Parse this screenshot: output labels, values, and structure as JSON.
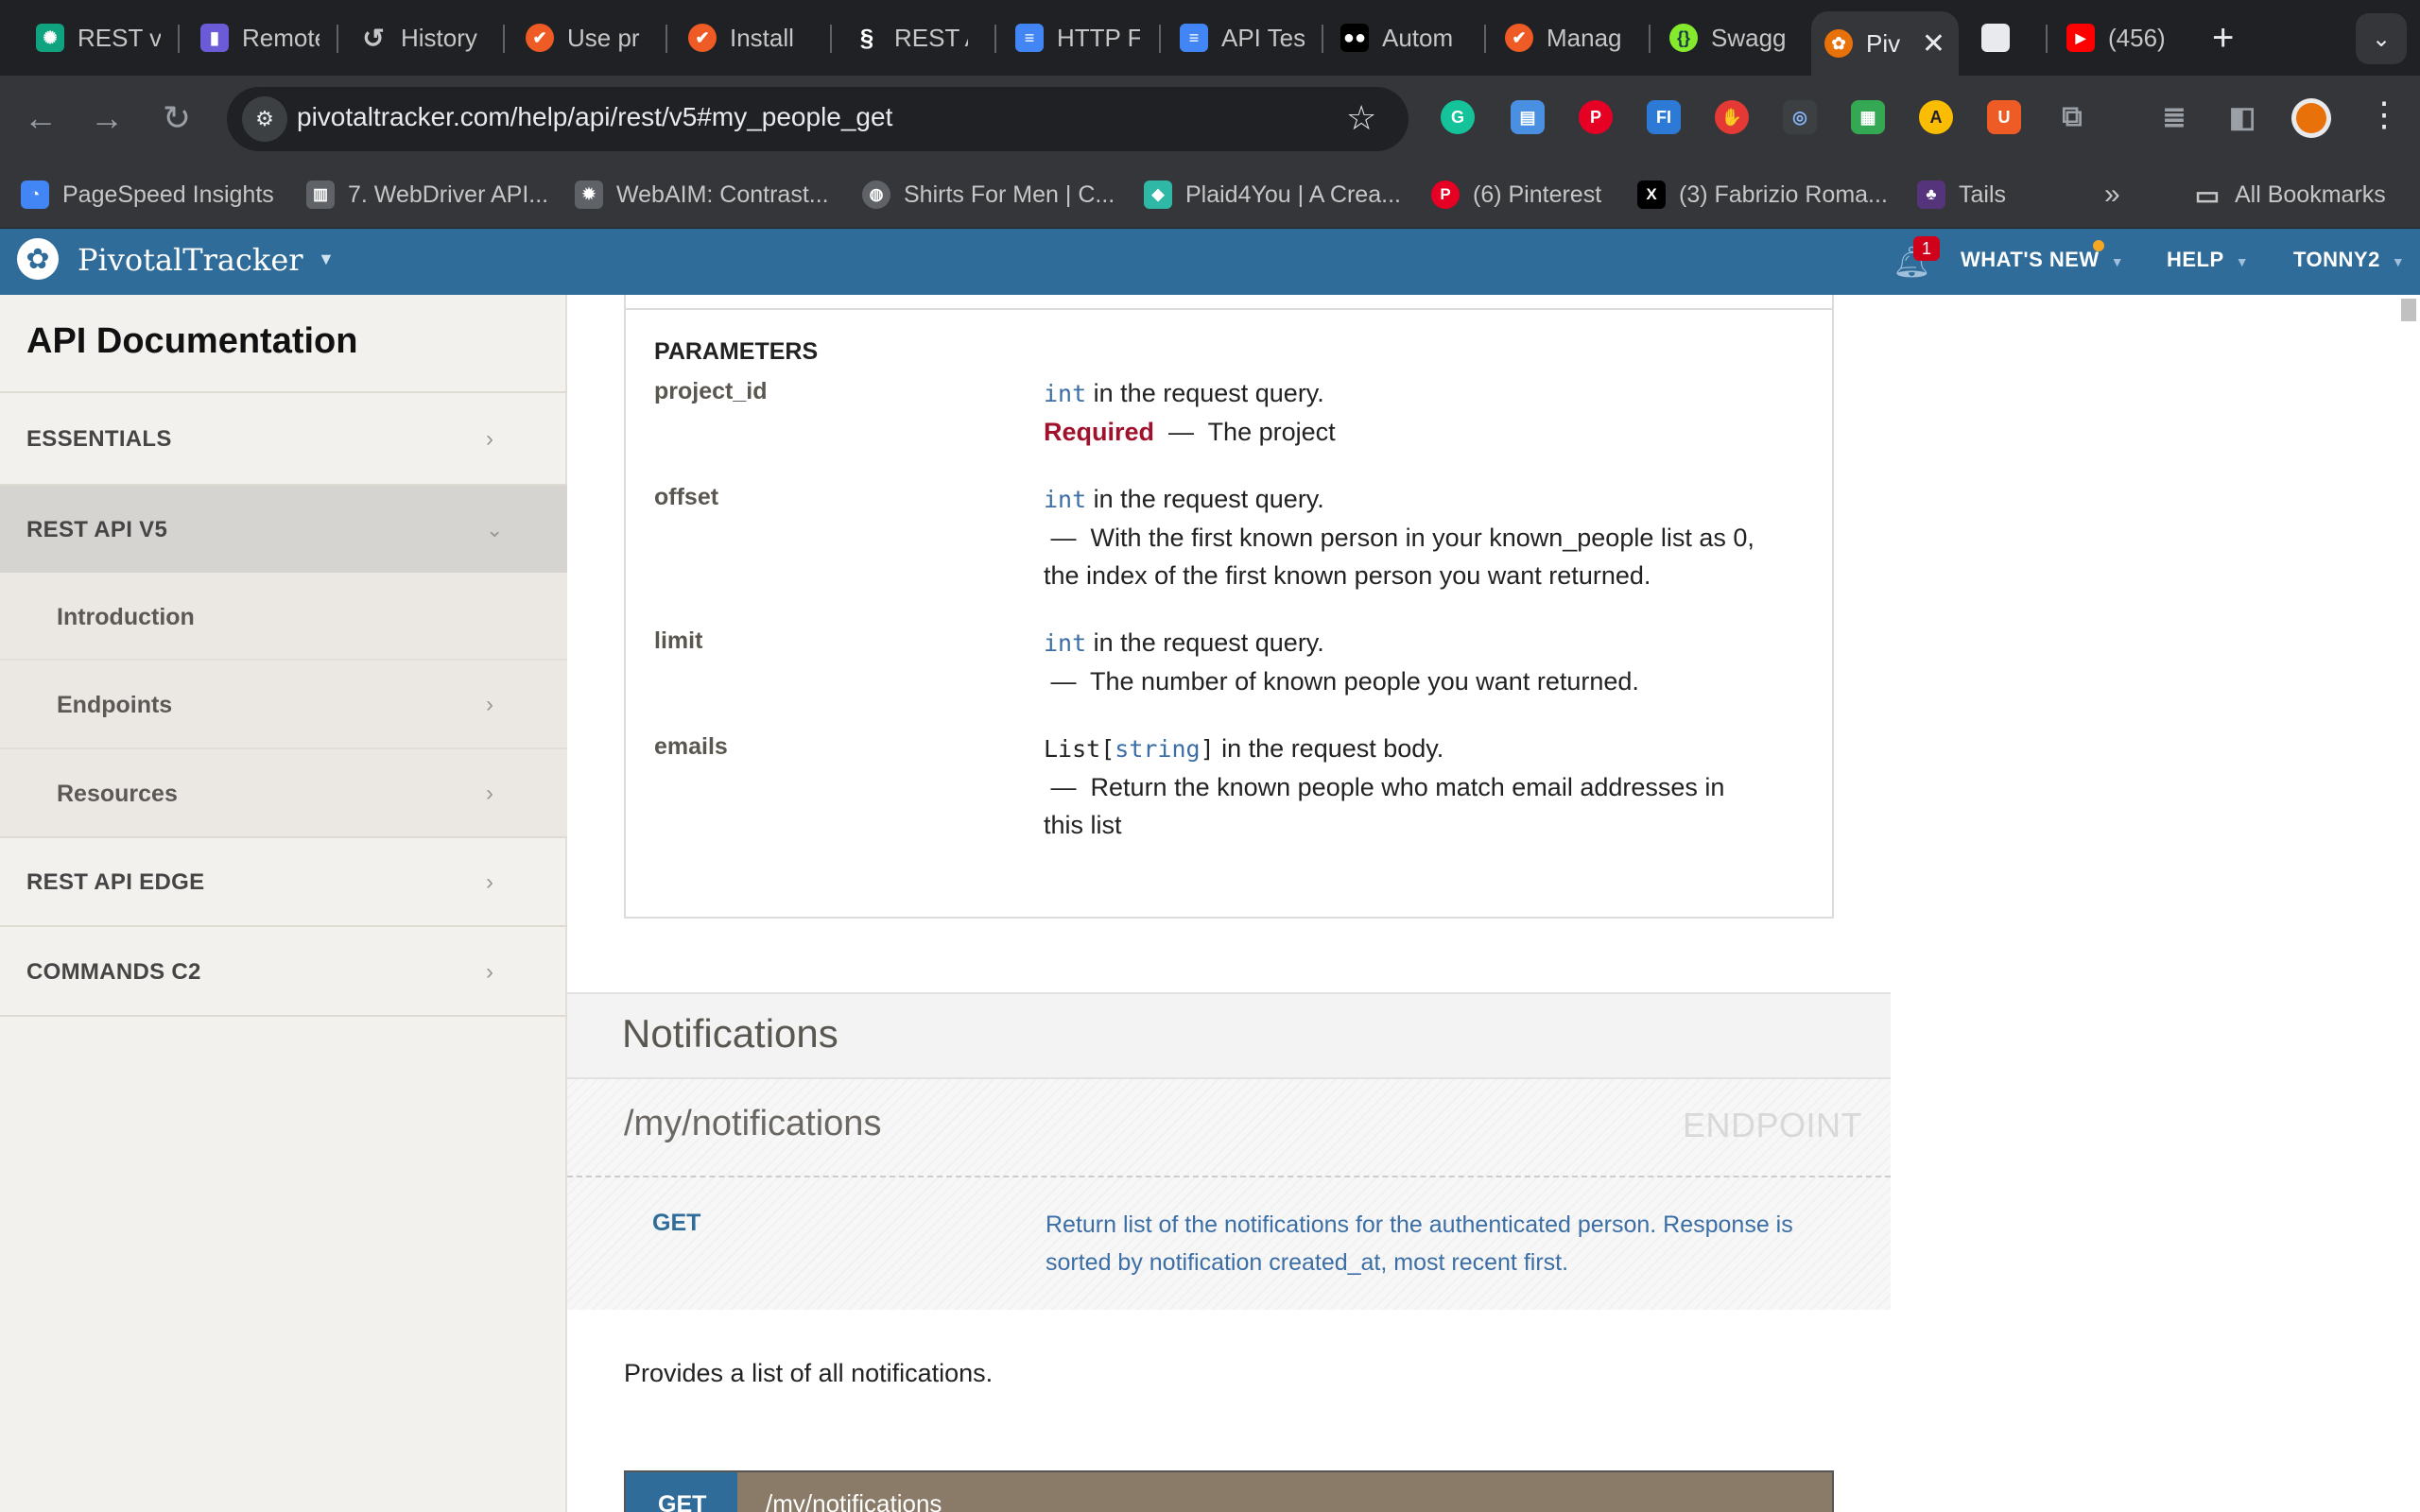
{
  "browser": {
    "tabs": [
      {
        "title": "REST v",
        "favicon": "chatgpt-icon",
        "color": "#10a37f"
      },
      {
        "title": "Remote",
        "favicon": "remote-icon",
        "color": "#6b5bd6"
      },
      {
        "title": "History",
        "favicon": "history-icon",
        "color": "#5f6368"
      },
      {
        "title": "Use pr",
        "favicon": "postman-icon",
        "color": "#ef5b25"
      },
      {
        "title": "Install",
        "favicon": "postman-icon",
        "color": "#ef5b25"
      },
      {
        "title": "REST A",
        "favicon": "rest-icon",
        "color": "#202124"
      },
      {
        "title": "HTTP F",
        "favicon": "docs-icon",
        "color": "#4285f4"
      },
      {
        "title": "API Tes",
        "favicon": "docs-icon",
        "color": "#4285f4"
      },
      {
        "title": "Autom",
        "favicon": "medium-icon",
        "color": "#000000"
      },
      {
        "title": "Manag",
        "favicon": "postman-icon",
        "color": "#ef5b25"
      },
      {
        "title": "Swagg",
        "favicon": "swagger-icon",
        "color": "#85ea2d"
      },
      {
        "title": "Piv",
        "favicon": "pivotal-icon",
        "color": "#e8710a",
        "active": true
      },
      {
        "title": "",
        "favicon": "blank-icon",
        "color": "#e8eaed"
      },
      {
        "title": "(456)",
        "favicon": "youtube-icon",
        "color": "#ff0000"
      }
    ],
    "url": "pivotaltracker.com/help/api/rest/v5#my_people_get",
    "bookmarks": [
      {
        "title": "PageSpeed Insights",
        "icon": "pagespeed-icon",
        "color": "#4285f4"
      },
      {
        "title": "7. WebDriver API...",
        "icon": "webdriver-icon",
        "color": "#5f6368"
      },
      {
        "title": "WebAIM: Contrast...",
        "icon": "webaim-icon",
        "color": "#5f6368"
      },
      {
        "title": "Shirts For Men | C...",
        "icon": "globe-icon",
        "color": "#5f6368"
      },
      {
        "title": "Plaid4You | A Crea...",
        "icon": "plaid-icon",
        "color": "#2fb8a6"
      },
      {
        "title": "(6) Pinterest",
        "icon": "pinterest-icon",
        "color": "#e60023"
      },
      {
        "title": "(3) Fabrizio Roma...",
        "icon": "x-icon",
        "color": "#000000"
      },
      {
        "title": "Tails",
        "icon": "tails-icon",
        "color": "#56347c"
      }
    ],
    "all_bookmarks": "All Bookmarks"
  },
  "header": {
    "logo": "PivotalTracker",
    "notification_count": "1",
    "nav": [
      "WHAT'S NEW",
      "HELP",
      "TONNY2"
    ]
  },
  "sidebar": {
    "title": "API Documentation",
    "items": [
      {
        "label": "ESSENTIALS"
      },
      {
        "label": "REST API V5"
      },
      {
        "label": "Introduction"
      },
      {
        "label": "Endpoints"
      },
      {
        "label": "Resources"
      },
      {
        "label": "REST API EDGE"
      },
      {
        "label": "COMMANDS C2"
      }
    ]
  },
  "parameters": {
    "heading": "PARAMETERS",
    "items": [
      {
        "name": "project_id",
        "type": "int",
        "location": " in the request query.",
        "required": "Required",
        "dash": "—",
        "desc": "The project"
      },
      {
        "name": "offset",
        "type": "int",
        "location": " in the request query.",
        "dash": "—",
        "desc": "With the first known person in your known_people list as 0, the index of the first known person you want returned."
      },
      {
        "name": "limit",
        "type": "int",
        "location": " in the request query.",
        "dash": "—",
        "desc": "The number of known people you want returned."
      },
      {
        "name": "emails",
        "type_prefix": "List[",
        "type": "string",
        "type_suffix": "]",
        "location": " in the request body.",
        "dash": "—",
        "desc": "Return the known people who match email addresses in this list"
      }
    ]
  },
  "notifications": {
    "section_title": "Notifications",
    "endpoint_path": "/my/notifications",
    "endpoint_label": "ENDPOINT",
    "method": "GET",
    "method_desc": "Return list of the notifications for the authenticated person. Response is sorted by notification created_at, most recent first.",
    "summary": "Provides a list of all notifications.",
    "request_method": "GET",
    "request_path": "/my/notifications"
  }
}
